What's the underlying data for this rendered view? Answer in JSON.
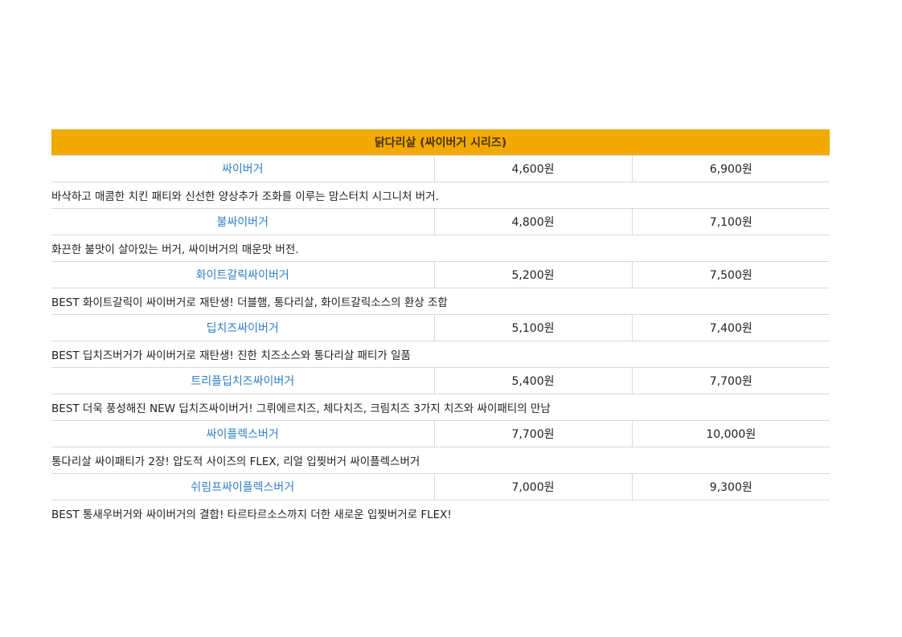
{
  "colors": {
    "header_background": "#f2a900",
    "name_link": "#2f7fc4",
    "divider": "#d9d9d9"
  },
  "menu": {
    "title": "닭다리살 (싸이버거 시리즈)",
    "items": [
      {
        "name": "싸이버거",
        "price_single": "4,600원",
        "price_set": "6,900원",
        "description": "바삭하고 매콤한 치킨 패티와 신선한 양상추가 조화를 이루는 맘스터치 시그니처 버거."
      },
      {
        "name": "불싸이버거",
        "price_single": "4,800원",
        "price_set": "7,100원",
        "description": "화끈한 불맛이 살아있는 버거, 싸이버거의 매운맛 버전."
      },
      {
        "name": "화이트갈릭싸이버거",
        "price_single": "5,200원",
        "price_set": "7,500원",
        "description": "BEST 화이트갈릭이 싸이버거로 재탄생! 더블햄, 통다리살, 화이트갈릭소스의 환상 조합"
      },
      {
        "name": "딥치즈싸이버거",
        "price_single": "5,100원",
        "price_set": "7,400원",
        "description": "BEST 딥치즈버거가 싸이버거로 재탄생! 진한 치즈소스와 통다리살 패티가 일품"
      },
      {
        "name": "트리플딥치즈싸이버거",
        "price_single": "5,400원",
        "price_set": "7,700원",
        "description": "BEST 더욱 풍성해진 NEW 딥치즈싸이버거! 그뤼에르치즈, 체다치즈, 크림치즈 3가지 치즈와 싸이패티의 만남"
      },
      {
        "name": "싸이플렉스버거",
        "price_single": "7,700원",
        "price_set": "10,000원",
        "description": "통다리살 싸이패티가 2장! 압도적 사이즈의 FLEX, 리얼 입찢버거 싸이플렉스버거"
      },
      {
        "name": "쉬림프싸이플렉스버거",
        "price_single": "7,000원",
        "price_set": "9,300원",
        "description": "BEST 통새우버거와 싸이버거의 결합! 타르타르소스까지 더한 새로운 입찢버거로 FLEX!"
      }
    ]
  }
}
